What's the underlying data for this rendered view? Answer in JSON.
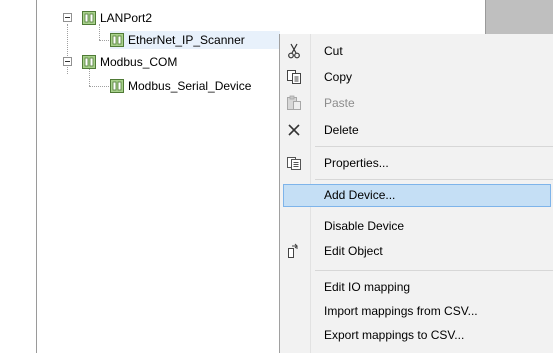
{
  "tree": {
    "items": [
      {
        "label": "LANPort2"
      },
      {
        "label": "EtherNet_IP_Scanner"
      },
      {
        "label": "Modbus_COM"
      },
      {
        "label": "Modbus_Serial_Device"
      }
    ]
  },
  "context_menu": {
    "items": [
      {
        "label": "Cut",
        "icon": "scissors-icon",
        "enabled": true
      },
      {
        "label": "Copy",
        "icon": "copy-icon",
        "enabled": true
      },
      {
        "label": "Paste",
        "icon": "paste-icon",
        "enabled": false
      },
      {
        "label": "Delete",
        "icon": "delete-icon",
        "enabled": true
      },
      {
        "label": "Properties...",
        "icon": "properties-icon",
        "enabled": true
      },
      {
        "label": "Add Device...",
        "highlighted": true
      },
      {
        "label": "Disable Device"
      },
      {
        "label": "Edit Object",
        "icon": "edit-object-icon"
      },
      {
        "label": "Edit IO mapping"
      },
      {
        "label": "Import mappings from CSV..."
      },
      {
        "label": "Export mappings to CSV..."
      }
    ]
  },
  "colors": {
    "highlight_bg": "#c5dff5",
    "highlight_border": "#7eb4ea",
    "menu_bg": "#f2f2f2",
    "disabled_text": "#8d8d8d"
  }
}
